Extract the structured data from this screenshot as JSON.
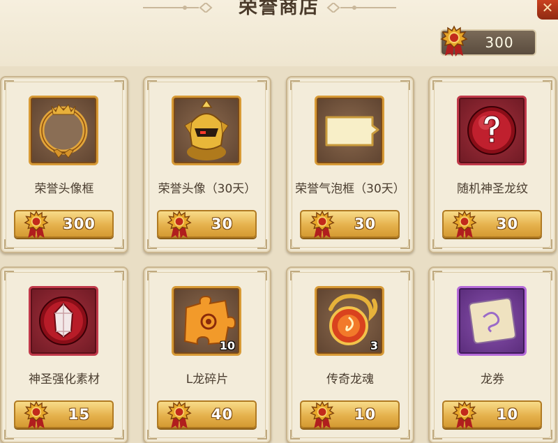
{
  "header": {
    "title": "荣誉商店",
    "close_symbol": "✕",
    "currency": {
      "icon": "honor-medal-icon",
      "amount": "300"
    }
  },
  "items": [
    {
      "name": "荣誉头像框",
      "price": "300",
      "qty": "",
      "icon": "honor-frame-icon",
      "rarity": "gold"
    },
    {
      "name": "荣誉头像（30天）",
      "price": "30",
      "qty": "",
      "icon": "golden-knight-avatar-icon",
      "rarity": "gold"
    },
    {
      "name": "荣誉气泡框（30天）",
      "price": "30",
      "qty": "",
      "icon": "speech-bubble-icon",
      "rarity": "gold"
    },
    {
      "name": "随机神圣龙纹",
      "price": "30",
      "qty": "",
      "icon": "question-orb-icon",
      "rarity": "red"
    },
    {
      "name": "神圣强化素材",
      "price": "15",
      "qty": "",
      "icon": "crystal-orb-icon",
      "rarity": "red"
    },
    {
      "name": "L龙碎片",
      "price": "40",
      "qty": "10",
      "icon": "puzzle-piece-icon",
      "rarity": "gold"
    },
    {
      "name": "传奇龙魂",
      "price": "10",
      "qty": "3",
      "icon": "dragon-soul-orb-icon",
      "rarity": "gold"
    },
    {
      "name": "龙券",
      "price": "10",
      "qty": "",
      "icon": "scroll-ticket-icon",
      "rarity": "purple"
    }
  ],
  "colors": {
    "background": "#ece2cc",
    "card": "#f3ecda",
    "price_button": "#e5b14c",
    "title_text": "#4a3a2a"
  }
}
